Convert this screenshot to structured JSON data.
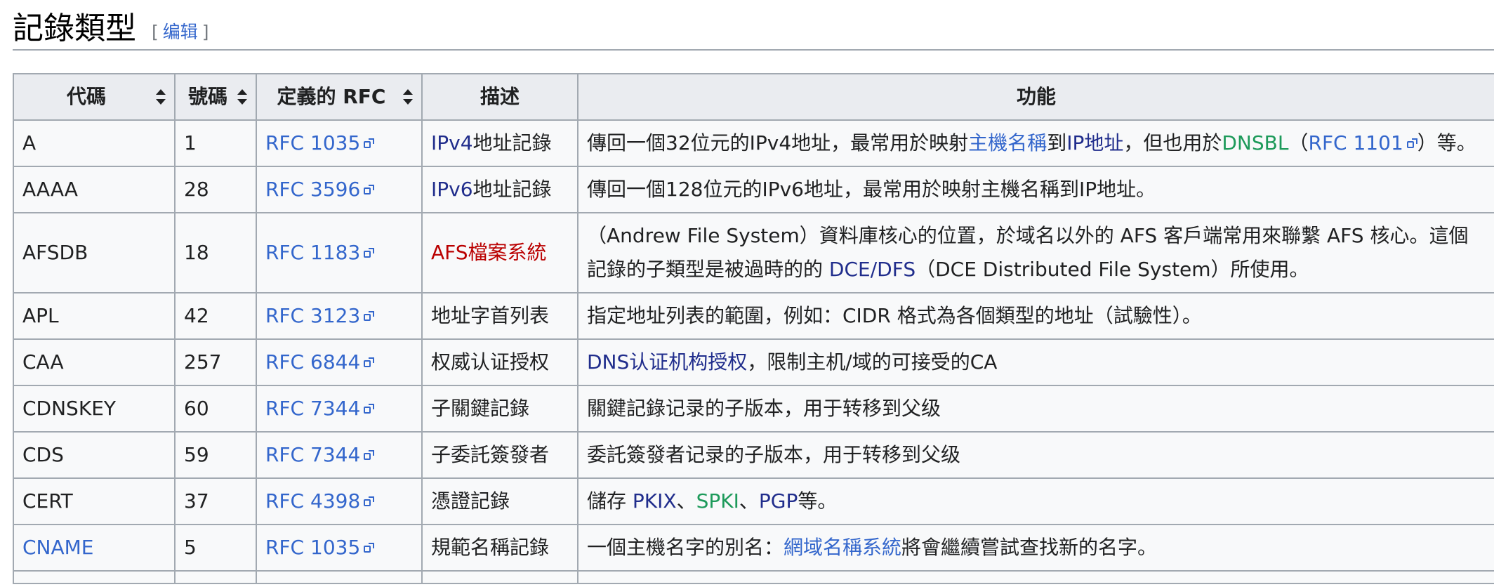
{
  "section": {
    "title": "記錄類型",
    "edit_open": "[",
    "edit_label": "编辑",
    "edit_close": "]"
  },
  "table": {
    "headers": {
      "code": "代碼",
      "number": "號碼",
      "rfc": "定義的 RFC",
      "desc": "描述",
      "func": "功能"
    },
    "rows": [
      {
        "code": "A",
        "number": "1",
        "rfc": "RFC 1035",
        "desc_link": "IPv4",
        "desc_rest": "地址記錄",
        "func": {
          "t1": "傳回一個32位元的IPv4地址，最常用於映射",
          "l1": "主機名稱",
          "t2": "到",
          "l2": "IP地址",
          "t3": "，但也用於",
          "l3": "DNSBL",
          "t4": "（",
          "l4": "RFC 1101",
          "t5": "）等。"
        }
      },
      {
        "code": "AAAA",
        "number": "28",
        "rfc": "RFC 3596",
        "desc_link": "IPv6",
        "desc_rest": "地址記錄",
        "func": "傳回一個128位元的IPv6地址，最常用於映射主機名稱到IP地址。"
      },
      {
        "code": "AFSDB",
        "number": "18",
        "rfc": "RFC 1183",
        "desc_link": "AFS檔案系統",
        "func": {
          "t1": "（Andrew File System）資料庫核心的位置，於域名以外的 AFS 客戶端常用來聯繫 AFS 核心。這個記錄的子類型是被過時的的 ",
          "l1": "DCE/DFS",
          "t2": "（DCE Distributed File System）所使用。"
        }
      },
      {
        "code": "APL",
        "number": "42",
        "rfc": "RFC 3123",
        "desc": "地址字首列表",
        "func": "指定地址列表的範圍，例如：CIDR 格式為各個類型的地址（試驗性）。"
      },
      {
        "code": "CAA",
        "number": "257",
        "rfc": "RFC 6844",
        "desc": "权威认证授权",
        "func": {
          "l1": "DNS认证机构授权",
          "t1": "，限制主机/域的可接受的CA"
        }
      },
      {
        "code": "CDNSKEY",
        "number": "60",
        "rfc": "RFC 7344",
        "desc": "子關鍵記錄",
        "func": "關鍵記錄记录的子版本，用于转移到父级"
      },
      {
        "code": "CDS",
        "number": "59",
        "rfc": "RFC 7344",
        "desc": "子委託簽發者",
        "func": "委託簽發者记录的子版本，用于转移到父级"
      },
      {
        "code": "CERT",
        "number": "37",
        "rfc": "RFC 4398",
        "desc": "憑證記錄",
        "func": {
          "t1": "儲存 ",
          "l1": "PKIX",
          "t2": "、",
          "l2": "SPKI",
          "t3": "、",
          "l3": "PGP",
          "t4": "等。"
        }
      },
      {
        "code": "CNAME",
        "number": "5",
        "rfc": "RFC 1035",
        "desc": "規範名稱記錄",
        "func": {
          "t1": "一個主機名字的別名：",
          "l1": "網域名稱系統",
          "t2": "將會繼續嘗試查找新的名字。"
        }
      }
    ]
  },
  "icons": {
    "sort": "sort-arrows-icon",
    "external": "external-link-icon"
  },
  "colors": {
    "link": "#3366cc",
    "visited_link": "#202d8c",
    "red_link": "#ba0000",
    "green_link": "#1d9a5a",
    "header_bg": "#eaecf0",
    "cell_bg": "#f8f9fa",
    "border": "#a2a9b1"
  }
}
